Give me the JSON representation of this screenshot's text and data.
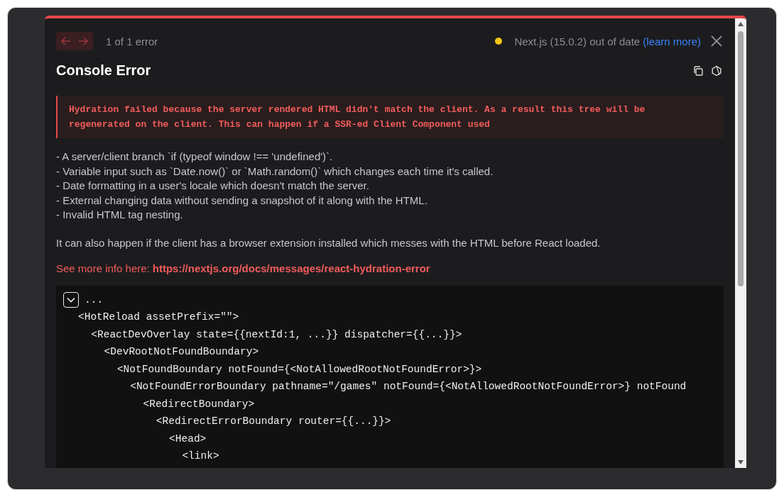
{
  "toolbar": {
    "nav": [
      {
        "kind": "prev",
        "disabled": true
      },
      {
        "kind": "next",
        "disabled": true
      }
    ],
    "counter": "1 of 1 error",
    "version_notice": {
      "text": "Next.js (15.0.2) out of date",
      "link": "(learn more)",
      "color": "#f5c518"
    }
  },
  "title": "Console Error",
  "message": "Hydration failed because the server rendered HTML didn't match the client. As a result this tree will be regenerated on the client. This can happen if a SSR-ed Client Component used",
  "causes": [
    "- A server/client branch `if (typeof window !== 'undefined')`.",
    "- Variable input such as `Date.now()` or `Math.random()` which changes each time it's called.",
    "- Date formatting in a user's locale which doesn't match the server.",
    "- External changing data without sending a snapshot of it along with the HTML.",
    "- Invalid HTML tag nesting."
  ],
  "note": "It can also happen if the client has a browser extension installed which messes with the HTML before React loaded.",
  "more_info": {
    "label": "See more info here:",
    "url": "https://nextjs.org/docs/messages/react-hydration-error"
  },
  "code": {
    "expanded": true,
    "first_line": "...",
    "tree": [
      {
        "text": "<HotReload assetPrefix=\"\">",
        "children": [
          {
            "text": "<ReactDevOverlay state={{nextId:1, ...}} dispatcher={{...}}>",
            "children": [
              {
                "text": "<DevRootNotFoundBoundary>",
                "children": [
                  {
                    "text": "<NotFoundBoundary notFound={<NotAllowedRootNotFoundError>}>",
                    "children": [
                      {
                        "text": "<NotFoundErrorBoundary pathname=\"/games\" notFound={<NotAllowedRootNotFoundError>} notFound",
                        "children": [
                          {
                            "text": "<RedirectBoundary>",
                            "children": [
                              {
                                "text": "<RedirectErrorBoundary router={{...}}>",
                                "children": [
                                  {
                                    "text": "<Head>",
                                    "children": [
                                      {
                                        "text": "<link>"
                                      }
                                    ]
                                  }
                                ]
                              }
                            ]
                          }
                        ]
                      }
                    ]
                  }
                ]
              }
            ]
          }
        ]
      }
    ]
  }
}
